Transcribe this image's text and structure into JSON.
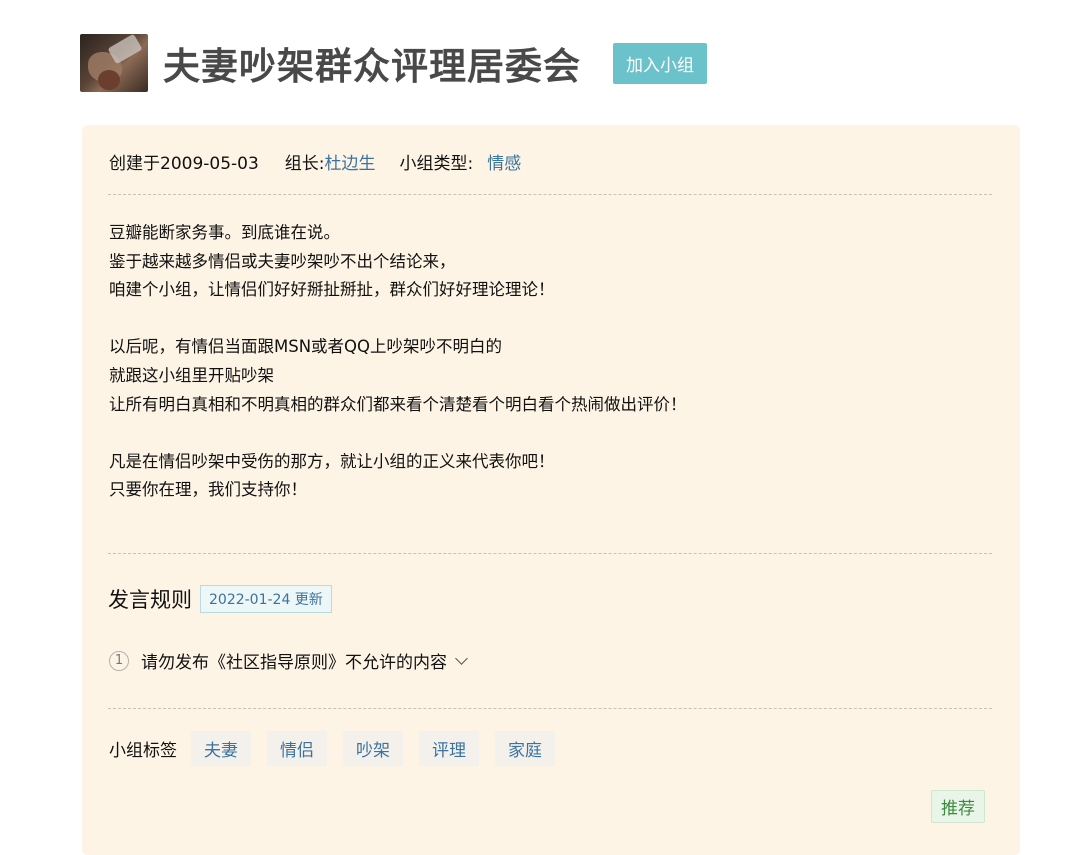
{
  "group": {
    "title": "夫妻吵架群众评理居委会",
    "join_label": "加入小组"
  },
  "meta": {
    "created": "创建于2009-05-03",
    "leader_label": "组长:",
    "leader_name": "杜边生",
    "type_label": "小组类型:",
    "type_value": "情感"
  },
  "intro": {
    "lines": [
      "豆瓣能断家务事。到底谁在说。",
      "鉴于越来越多情侣或夫妻吵架吵不出个结论来，",
      "咱建个小组，让情侣们好好掰扯掰扯，群众们好好理论理论！",
      "",
      "以后呢，有情侣当面跟MSN或者QQ上吵架吵不明白的",
      "就跟这小组里开贴吵架",
      "让所有明白真相和不明真相的群众们都来看个清楚看个明白看个热闹做出评价！",
      "",
      "凡是在情侣吵架中受伤的那方，就让小组的正义来代表你吧！",
      "只要你在理，我们支持你！"
    ]
  },
  "rules": {
    "title": "发言规则",
    "update_badge": "2022-01-24 更新",
    "items": [
      {
        "num": "1",
        "text": "请勿发布《社区指导原则》不允许的内容"
      }
    ]
  },
  "tags": {
    "label": "小组标签",
    "items": [
      "夫妻",
      "情侣",
      "吵架",
      "评理",
      "家庭"
    ]
  },
  "recommend_label": "推荐"
}
